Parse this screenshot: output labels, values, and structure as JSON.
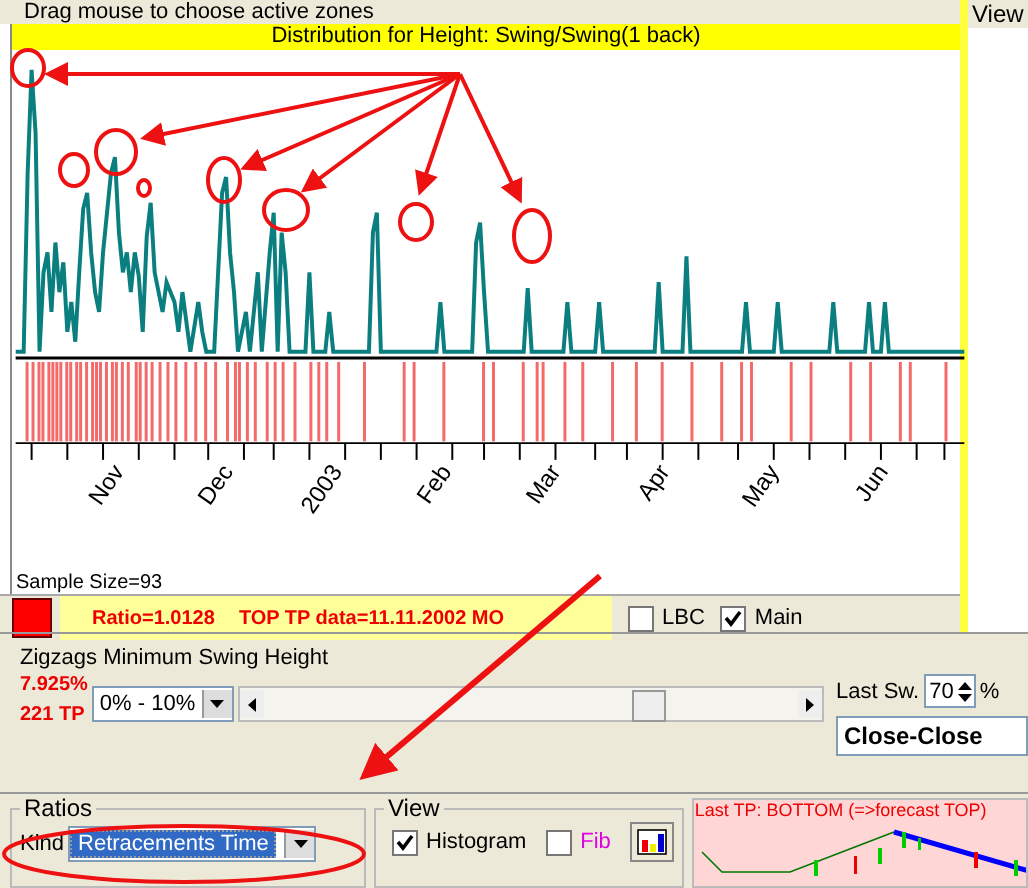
{
  "top_hint": "Drag mouse to choose active zones",
  "side_panel": {
    "title": "View"
  },
  "chart": {
    "title": "Distribution for Height: Swing/Swing(1 back)",
    "month_labels": [
      "Nov",
      "Dec",
      "2003",
      "Feb",
      "Mar",
      "Apr",
      "May",
      "Jun"
    ],
    "sample_size": "Sample Size=93"
  },
  "status": {
    "ratio": "Ratio=1.0128",
    "top_tp": "TOP TP data=11.11.2002 MO",
    "options": [
      {
        "label": "LBC",
        "checked": false
      },
      {
        "label": "Main",
        "checked": true
      }
    ]
  },
  "zigzags": {
    "title": "Zigzags Minimum Swing Height",
    "percent": "7.925%",
    "tp_count": "221 TP",
    "range": "0% - 10%",
    "slider": {
      "level": 0.72
    },
    "last_swing_label": "Last Sw.",
    "last_swing": "70",
    "unit": "%",
    "price_mode": "Close-Close"
  },
  "ratios": {
    "title": "Ratios",
    "kind_label": "Kind",
    "kind": "Retracements Time"
  },
  "view": {
    "title": "View",
    "options": [
      {
        "label": "Histogram",
        "checked": true,
        "kind": "plain"
      },
      {
        "label": "Fib",
        "checked": false,
        "kind": "accent"
      }
    ]
  },
  "forecast": {
    "title": "Last TP: BOTTOM (=>forecast TOP)"
  }
}
